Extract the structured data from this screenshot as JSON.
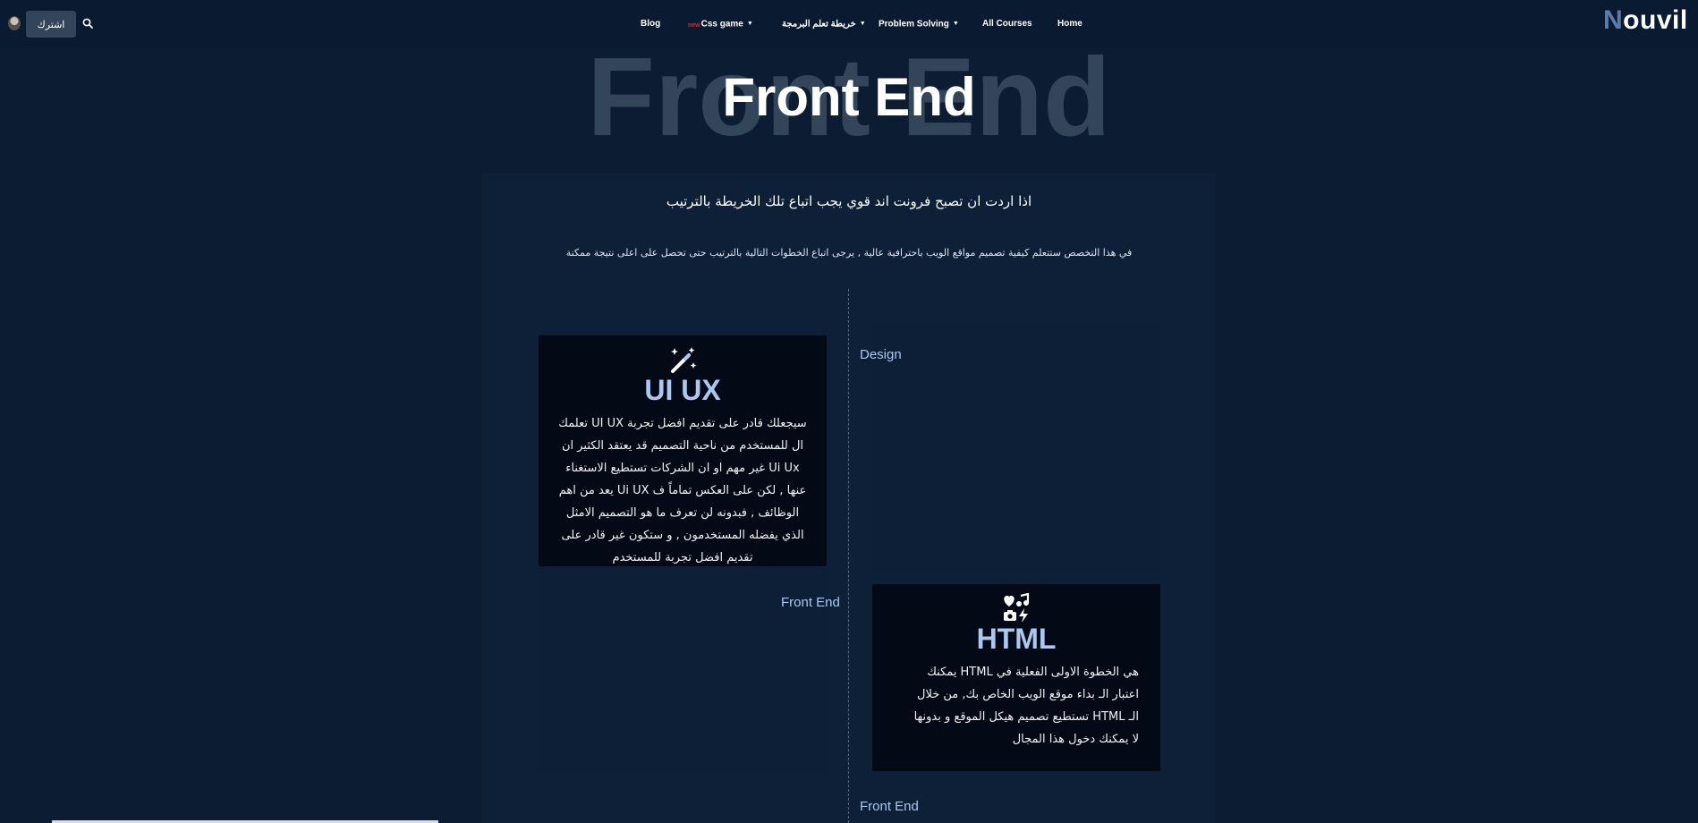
{
  "nav": {
    "subscribe_label": "اشترك",
    "items": [
      {
        "label": "Blog"
      },
      {
        "badge": "new",
        "label": "Css game"
      },
      {
        "label": "خريطة تعلم البرمجة"
      },
      {
        "label": "Problem Solving"
      },
      {
        "label": "All Courses"
      },
      {
        "label": "Home"
      }
    ],
    "logo_first": "N",
    "logo_rest": "ouvil"
  },
  "hero": {
    "background_text": "Front End",
    "title": "Front End"
  },
  "intro": {
    "heading": "اذا اردت ان تصبح فرونت اند قوي يجب اتباع تلك الخريطة بالترتيب",
    "text": "في هذا التخصص ستتعلم كيفية تصميم مواقع الويب باحترافية عالية , يرجى اتباع الخطوات التالية بالترتيب حتى تحصل على اعلى نتيجة ممكنة"
  },
  "roadmap": {
    "labels": [
      "Design",
      "Front End",
      "Front End"
    ],
    "cards": [
      {
        "icon": "magic-wand-icon",
        "title": "UI UX",
        "text": "سيجعلك قادر على تقديم افضل تجربة UI UX تعلمك ال للمستخدم من ناحية التصميم قد يعتقد الكثير ان Ui Ux غير مهم او ان الشركات تستطيع الاستغناء عنها , لكن على العكس تماماً ف Ui UX يعد من اهم الوظائف , فبدونه لن تعرف ما هو التصميم الامثل الذي يفضله المستخدمون , و ستكون غير قادر على تقديم افضل تجربة للمستخدم"
      },
      {
        "icon": "icons-collection-icon",
        "title": "HTML",
        "text": "هي الخطوة الاولى الفعلية في HTML يمكنك اعتبار الـ بداء موقع الويب الخاص بك, من خلال الـ HTML تستطيع تصميم هيكل الموقع و بدونها لا يمكنك دخول هذا المجال"
      }
    ]
  }
}
